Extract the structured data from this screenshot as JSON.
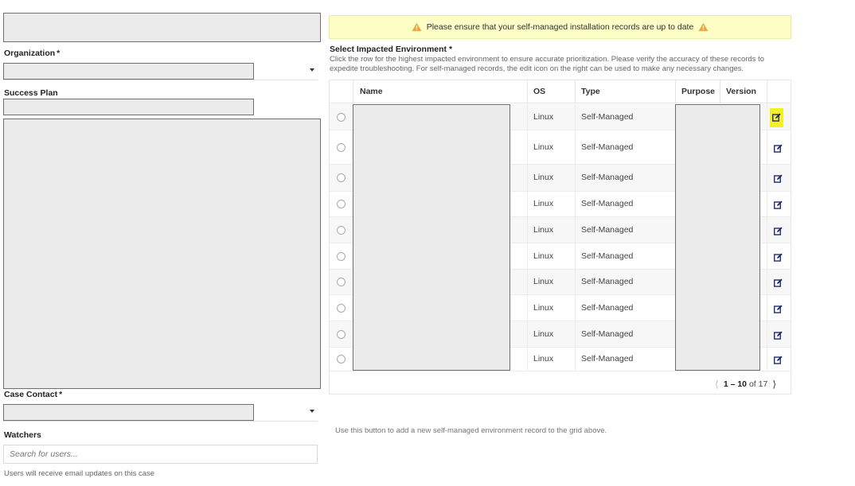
{
  "left": {
    "organization_label": "Organization",
    "success_plan_label": "Success Plan",
    "case_contact_label": "Case Contact",
    "required_mark": "*",
    "watchers_label": "Watchers",
    "watchers_placeholder": "Search for users...",
    "watchers_help": "Users will receive email updates on this case"
  },
  "banner": {
    "text": "Please ensure that your self-managed installation records are up to date",
    "icon": "warning-icon",
    "color": "#fdfdc6"
  },
  "environment": {
    "title": "Select Impacted Environment *",
    "instructions": "Click the row for the highest impacted environment to ensure accurate prioritization. Please verify the accuracy of these records to expedite troubleshooting. For self-managed records, the edit icon on the right can be used to make any necessary changes.",
    "columns": {
      "name": "Name",
      "os": "OS",
      "type": "Type",
      "purpose": "Purpose",
      "version": "Version"
    },
    "rows": [
      {
        "os": "Linux",
        "type": "Self-Managed"
      },
      {
        "os": "Linux",
        "type": "Self-Managed"
      },
      {
        "os": "Linux",
        "type": "Self-Managed"
      },
      {
        "os": "Linux",
        "type": "Self-Managed"
      },
      {
        "os": "Linux",
        "type": "Self-Managed"
      },
      {
        "os": "Linux",
        "type": "Self-Managed"
      },
      {
        "os": "Linux",
        "type": "Self-Managed"
      },
      {
        "os": "Linux",
        "type": "Self-Managed"
      },
      {
        "os": "Linux",
        "type": "Self-Managed"
      },
      {
        "os": "Linux",
        "type": "Self-Managed"
      }
    ],
    "pager": {
      "range": "1 – 10",
      "of_text": "of",
      "total": "17"
    },
    "add_note": "Use this button to add a new self-managed environment record to the grid above.",
    "highlight_color": "#f3f028"
  }
}
